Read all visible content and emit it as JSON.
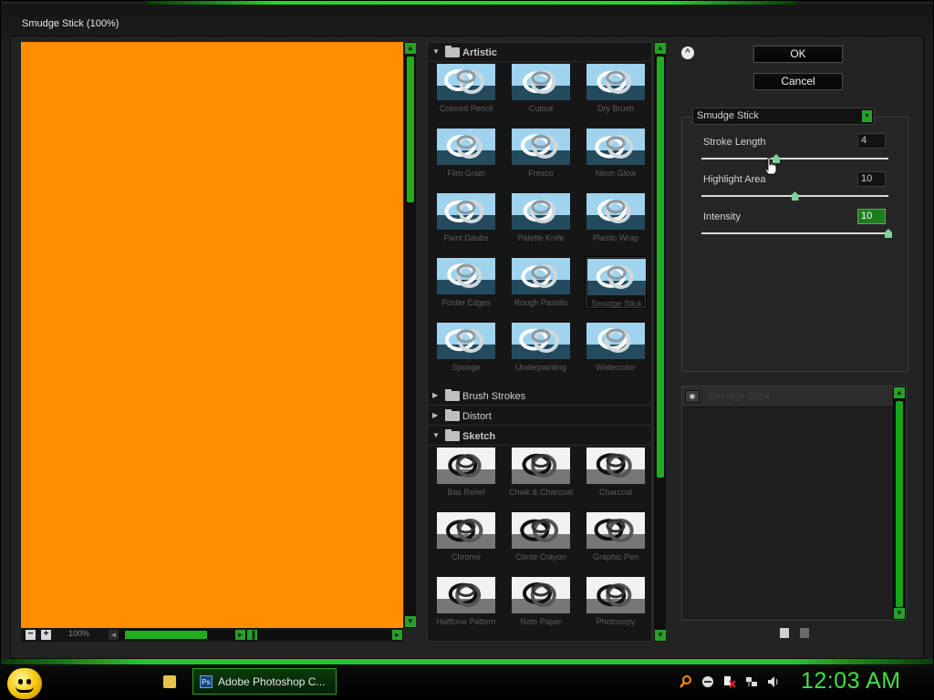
{
  "window": {
    "title": "Smudge Stick (100%)"
  },
  "preview": {
    "zoom": "100%",
    "zoom_out": "−",
    "zoom_in": "+"
  },
  "gallery": {
    "groups": [
      {
        "name": "Artistic",
        "expanded": true,
        "items": [
          "Colored Pencil",
          "Cutout",
          "Dry Brush",
          "Film Grain",
          "Fresco",
          "Neon Glow",
          "Paint Daubs",
          "Palette Knife",
          "Plastic Wrap",
          "Poster Edges",
          "Rough Pastels",
          "Smudge Stick",
          "Sponge",
          "Underpainting",
          "Watercolor"
        ],
        "selected": "Smudge Stick"
      },
      {
        "name": "Brush Strokes",
        "expanded": false
      },
      {
        "name": "Distort",
        "expanded": false
      },
      {
        "name": "Sketch",
        "expanded": true,
        "items": [
          "Bas Relief",
          "Chalk & Charcoal",
          "Charcoal",
          "Chrome",
          "Conté Crayon",
          "Graphic Pen",
          "Halftone Pattern",
          "Note Paper",
          "Photocopy"
        ]
      }
    ]
  },
  "buttons": {
    "ok": "OK",
    "cancel": "Cancel",
    "collapse": "^"
  },
  "filter": {
    "selected": "Smudge Stick",
    "params": [
      {
        "label": "Stroke Length",
        "value": "4",
        "fraction": 0.4
      },
      {
        "label": "Highlight Area",
        "value": "10",
        "fraction": 0.5
      },
      {
        "label": "Intensity",
        "value": "10",
        "fraction": 1.0
      }
    ]
  },
  "layers": {
    "items": [
      "Smudge Stick"
    ]
  },
  "taskbar": {
    "task": "Adobe Photoshop C...",
    "ps_badge": "Ps",
    "clock": "12:03 AM"
  },
  "colors": {
    "preview": "#ff8e00",
    "accent": "#25c625",
    "clock": "#3fe03f"
  }
}
